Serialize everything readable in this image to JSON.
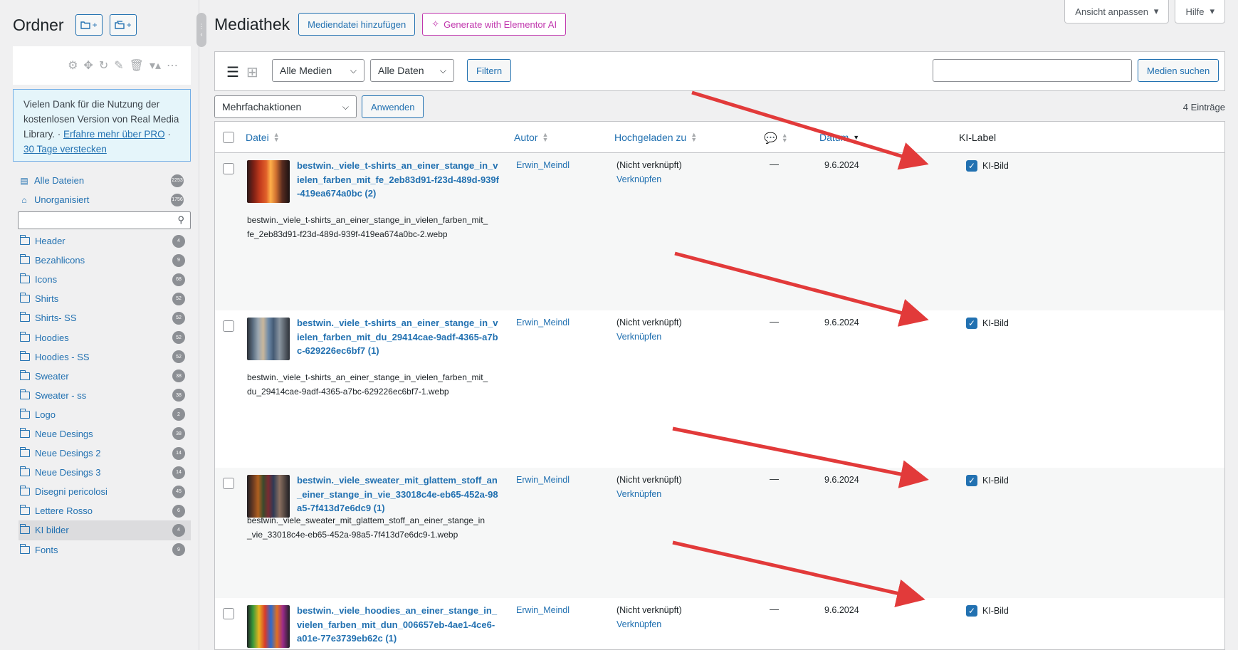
{
  "sidebar": {
    "title": "Ordner",
    "add_folder_plus": "+",
    "add_collection_plus": "+",
    "notice": {
      "text": "Vielen Dank für die Nutzung der kostenlosen Version von Real Media Library. · ",
      "learn_more": "Erfahre mehr über PRO",
      "separator": " · ",
      "hide": "30 Tage verstecken"
    },
    "all_files": {
      "label": "Alle Dateien",
      "count": "2253"
    },
    "unorganized": {
      "label": "Unorganisiert",
      "count": "1756"
    },
    "folders": [
      {
        "label": "Header",
        "count": "4"
      },
      {
        "label": "Bezahlicons",
        "count": "9"
      },
      {
        "label": "Icons",
        "count": "68"
      },
      {
        "label": "Shirts",
        "count": "52"
      },
      {
        "label": "Shirts- SS",
        "count": "52"
      },
      {
        "label": "Hoodies",
        "count": "52"
      },
      {
        "label": "Hoodies - SS",
        "count": "52"
      },
      {
        "label": "Sweater",
        "count": "38"
      },
      {
        "label": "Sweater - ss",
        "count": "38"
      },
      {
        "label": "Logo",
        "count": "2"
      },
      {
        "label": "Neue Desings",
        "count": "38"
      },
      {
        "label": "Neue Desings 2",
        "count": "14"
      },
      {
        "label": "Neue Desings 3",
        "count": "14"
      },
      {
        "label": "Disegni pericolosi",
        "count": "45"
      },
      {
        "label": "Lettere Rosso",
        "count": "6"
      },
      {
        "label": "KI bilder",
        "count": "4"
      },
      {
        "label": "Fonts",
        "count": "9"
      }
    ]
  },
  "header": {
    "title": "Mediathek",
    "add_media": "Mediendatei hinzufügen",
    "ai_button": "Generate with Elementor AI",
    "screen_options": "Ansicht anpassen",
    "help": "Hilfe"
  },
  "filters": {
    "media_type": "Alle Medien",
    "dates": "Alle Daten",
    "filter_button": "Filtern",
    "search_button": "Medien suchen",
    "search_value": ""
  },
  "bulk": {
    "action": "Mehrfachaktionen",
    "apply": "Anwenden",
    "entries": "4 Einträge"
  },
  "table": {
    "columns": {
      "file": "Datei",
      "author": "Autor",
      "uploaded_to": "Hochgeladen zu",
      "date": "Datum",
      "ki_label": "KI-Label"
    },
    "rows": [
      {
        "title": "bestwin._viele_t-shirts_an_einer_stange_in_vielen_farben_mit_fe_2eb83d91-f23d-489d-939f-419ea674a0bc (2)",
        "filename": "bestwin._viele_t-shirts_an_einer_stange_in_vielen_farben_mit_fe_2eb83d91-f23d-489d-939f-419ea674a0bc-2.webp",
        "author": "Erwin_Meindl",
        "uploaded": "(Nicht verknüpft)",
        "attach": "Verknüpfen",
        "comments": "—",
        "date": "9.6.2024",
        "ki": "KI-Bild"
      },
      {
        "title": "bestwin._viele_t-shirts_an_einer_stange_in_vielen_farben_mit_du_29414cae-9adf-4365-a7bc-629226ec6bf7 (1)",
        "filename": "bestwin._viele_t-shirts_an_einer_stange_in_vielen_farben_mit_du_29414cae-9adf-4365-a7bc-629226ec6bf7-1.webp",
        "author": "Erwin_Meindl",
        "uploaded": "(Nicht verknüpft)",
        "attach": "Verknüpfen",
        "comments": "—",
        "date": "9.6.2024",
        "ki": "KI-Bild"
      },
      {
        "title": "bestwin._viele_sweater_mit_glattem_stoff_an_einer_stange_in_vie_33018c4e-eb65-452a-98a5-7f413d7e6dc9 (1)",
        "filename": "bestwin._viele_sweater_mit_glattem_stoff_an_einer_stange_in_vie_33018c4e-eb65-452a-98a5-7f413d7e6dc9-1.webp",
        "author": "Erwin_Meindl",
        "uploaded": "(Nicht verknüpft)",
        "attach": "Verknüpfen",
        "comments": "—",
        "date": "9.6.2024",
        "ki": "KI-Bild"
      },
      {
        "title": "bestwin._viele_hoodies_an_einer_stange_in_vielen_farben_mit_dun_006657eb-4ae1-4ce6-a01e-77e3739eb62c (1)",
        "filename": "",
        "author": "Erwin_Meindl",
        "uploaded": "(Nicht verknüpft)",
        "attach": "Verknüpfen",
        "comments": "—",
        "date": "9.6.2024",
        "ki": "KI-Bild"
      }
    ]
  },
  "colors": {
    "accent": "#2271b1",
    "arrow": "#e23a3a",
    "ai": "#c036ad"
  }
}
